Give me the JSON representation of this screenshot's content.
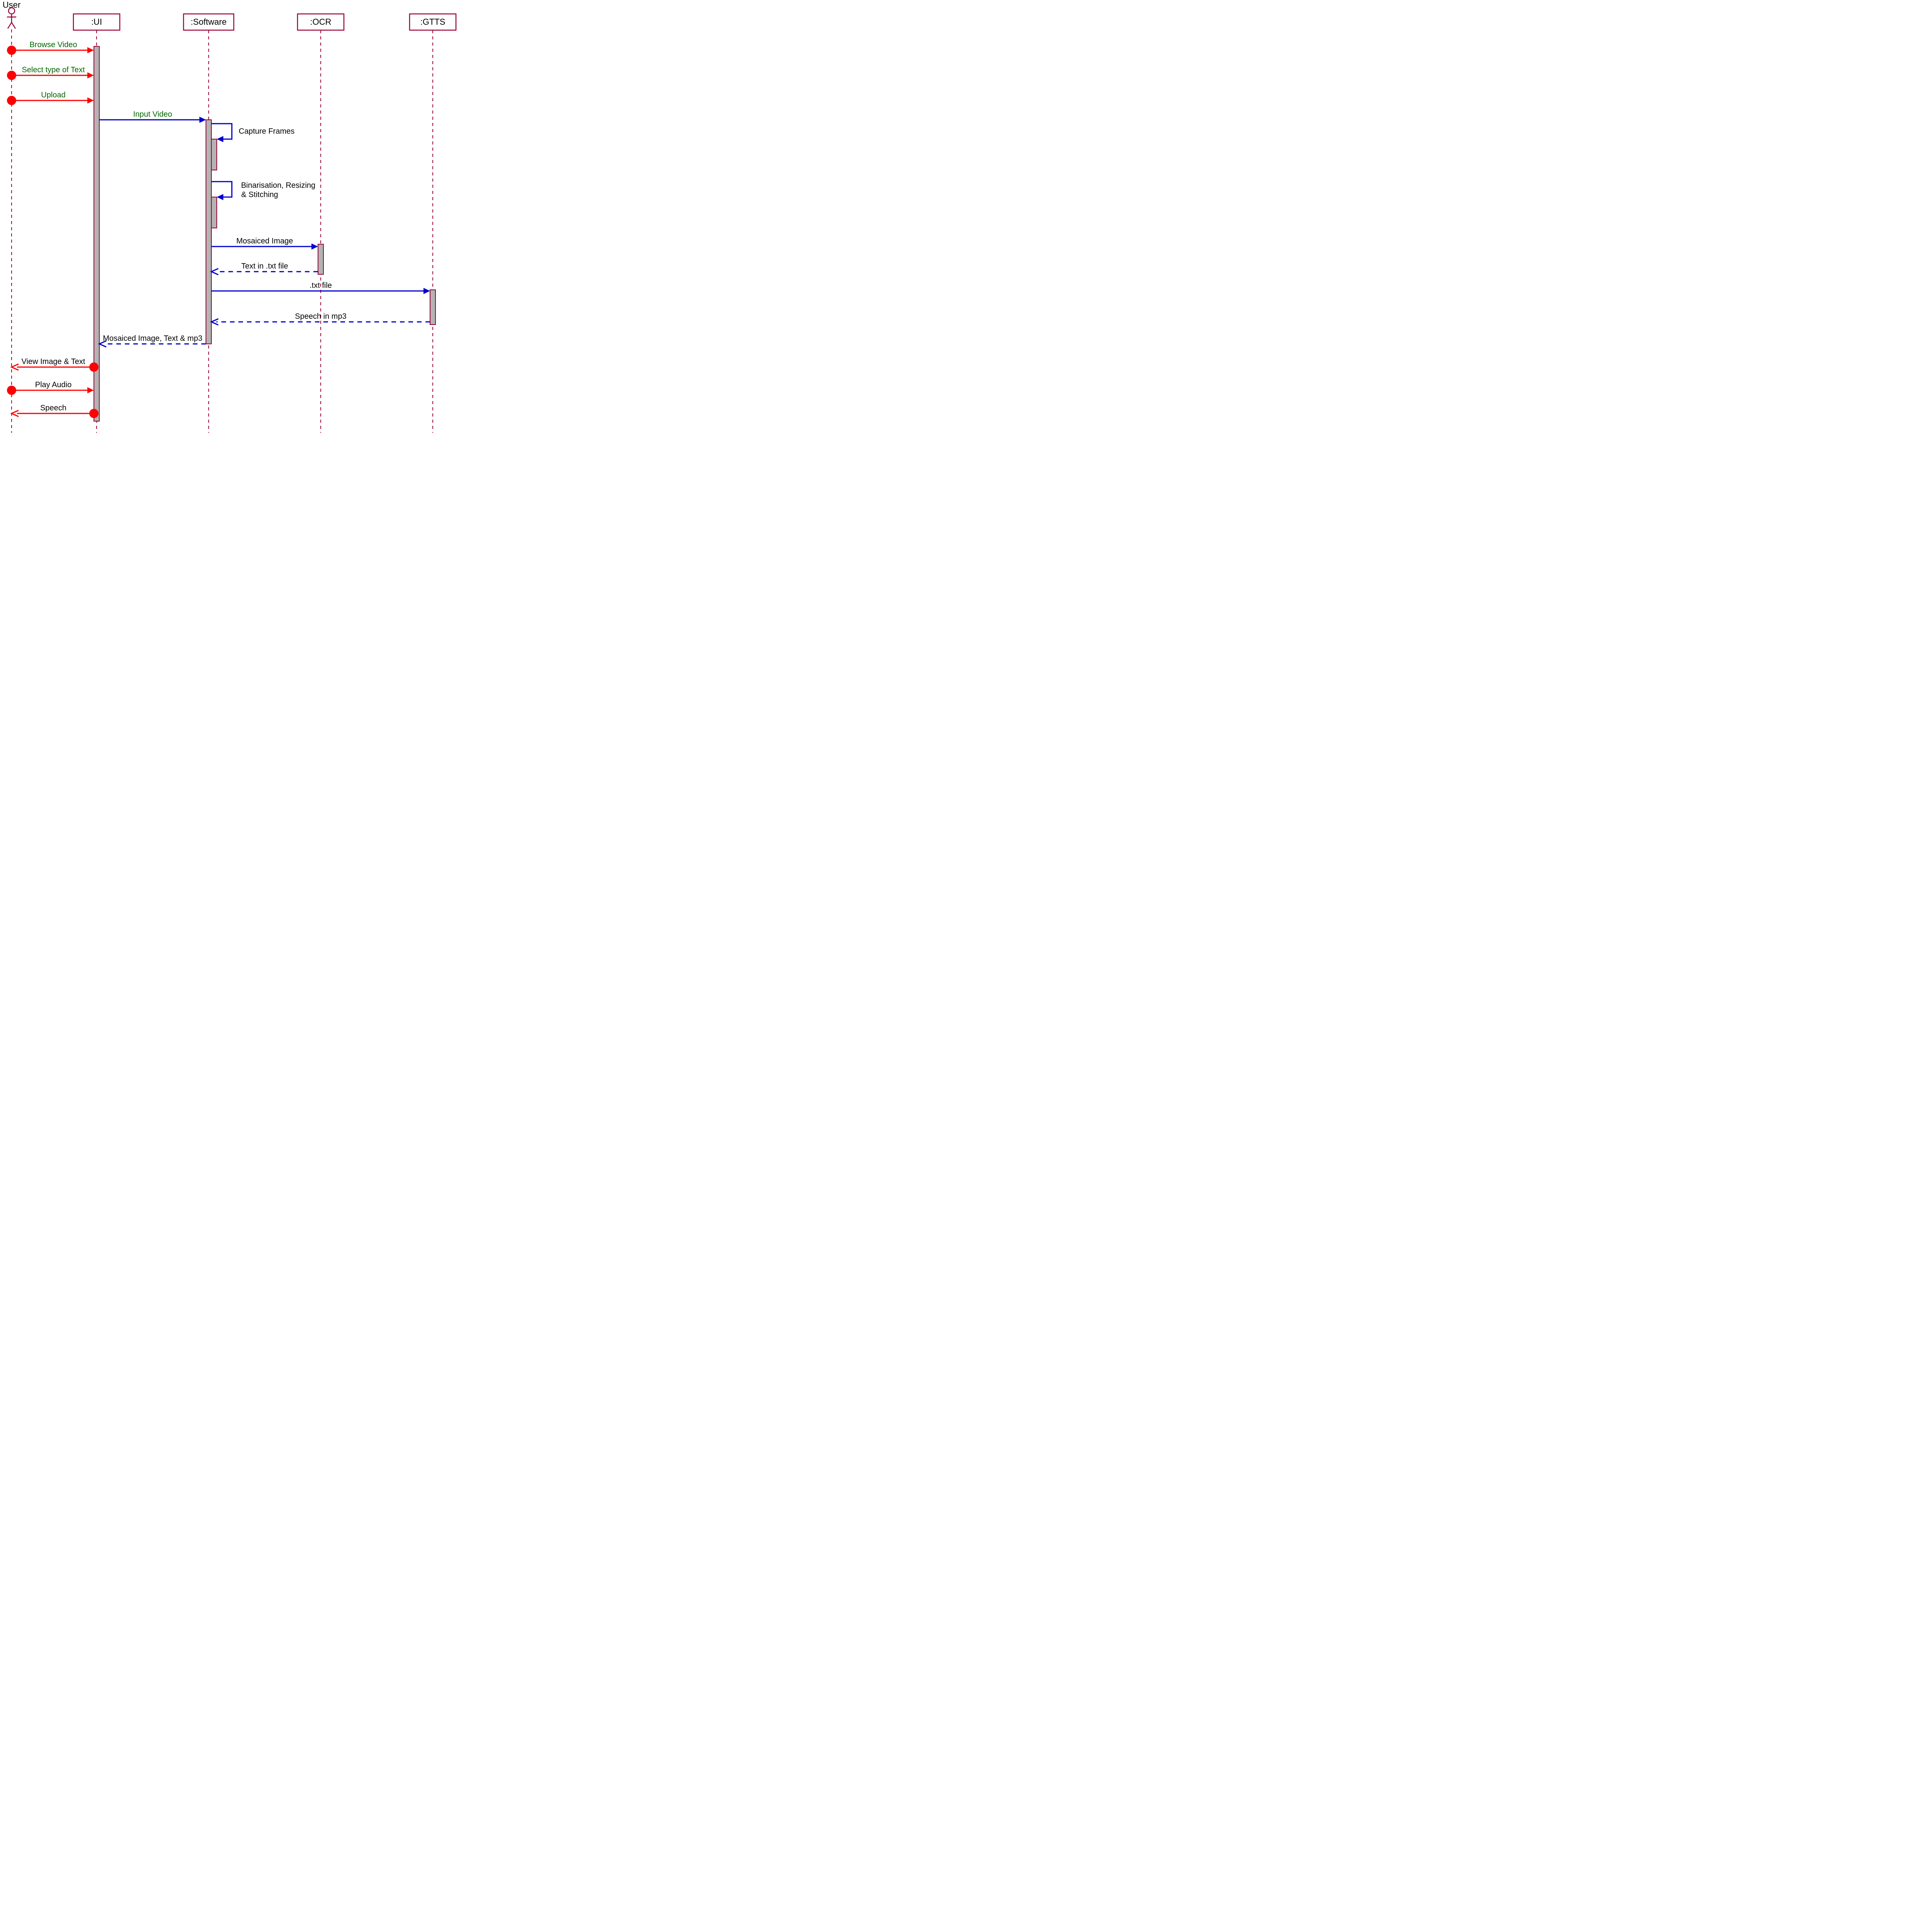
{
  "participants": {
    "user": "User",
    "ui": ":UI",
    "software": ":Software",
    "ocr": ":OCR",
    "gtts": ":GTTS"
  },
  "messages": {
    "m1": "Browse Video",
    "m2": "Select type of Text",
    "m3": "Upload",
    "m4": "Input Video",
    "m5": "Capture Frames",
    "m6a": "Binarisation, Resizing",
    "m6b": "& Stitching",
    "m7": "Mosaiced Image",
    "m8": "Text in .txt file",
    "m9": ".txt file",
    "m10": "Speech in mp3",
    "m11": "Mosaiced Image, Text & mp3",
    "m12": "View Image & Text",
    "m13": "Play Audio",
    "m14": "Speech"
  }
}
